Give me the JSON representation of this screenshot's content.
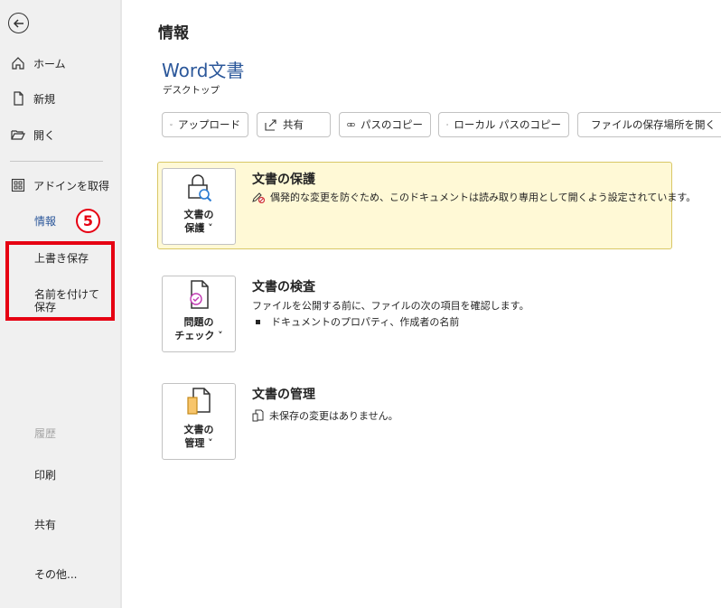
{
  "sidebar": {
    "back_icon": "back-arrow-icon",
    "items": [
      {
        "label": "ホーム",
        "icon": "home-icon"
      },
      {
        "label": "新規",
        "icon": "new-document-icon"
      },
      {
        "label": "開く",
        "icon": "open-folder-icon"
      },
      {
        "label": "アドインを取得",
        "icon": "addins-grid-icon"
      }
    ],
    "info_label": "情報",
    "save_label": "上書き保存",
    "save_as_label": "名前を付けて保存",
    "history_label": "履歴",
    "print_label": "印刷",
    "share_label": "共有",
    "more_label": "その他..."
  },
  "annotation": {
    "step": "5",
    "color": "#e60012"
  },
  "main": {
    "page_title": "情報",
    "doc_title": "Word文書",
    "doc_location": "デスクトップ",
    "toolbar": [
      {
        "label": "アップロード",
        "icon": "cloud-upload-icon"
      },
      {
        "label": "共有",
        "icon": "share-icon"
      },
      {
        "label": "パスのコピー",
        "icon": "link-icon"
      },
      {
        "label": "ローカル パスのコピー",
        "icon": "link-icon"
      },
      {
        "label": "ファイルの保存場所を開く",
        "icon": "folder-icon"
      }
    ],
    "protect": {
      "button_label_1": "文書の",
      "button_label_2": "保護 ˅",
      "title": "文書の保護",
      "description": "偶発的な変更を防ぐため、このドキュメントは読み取り専用として開くよう設定されています。"
    },
    "inspect": {
      "button_label_1": "問題の",
      "button_label_2": "チェック ˅",
      "title": "文書の検査",
      "description": "ファイルを公開する前に、ファイルの次の項目を確認します。",
      "bullet": "ドキュメントのプロパティ、作成者の名前"
    },
    "manage": {
      "button_label_1": "文書の",
      "button_label_2": "管理 ˅",
      "title": "文書の管理",
      "description": "未保存の変更はありません。"
    }
  },
  "colors": {
    "accent": "#2b579a",
    "warning_bg": "#fff9d6",
    "sidebar_bg": "#f0f0f0"
  }
}
